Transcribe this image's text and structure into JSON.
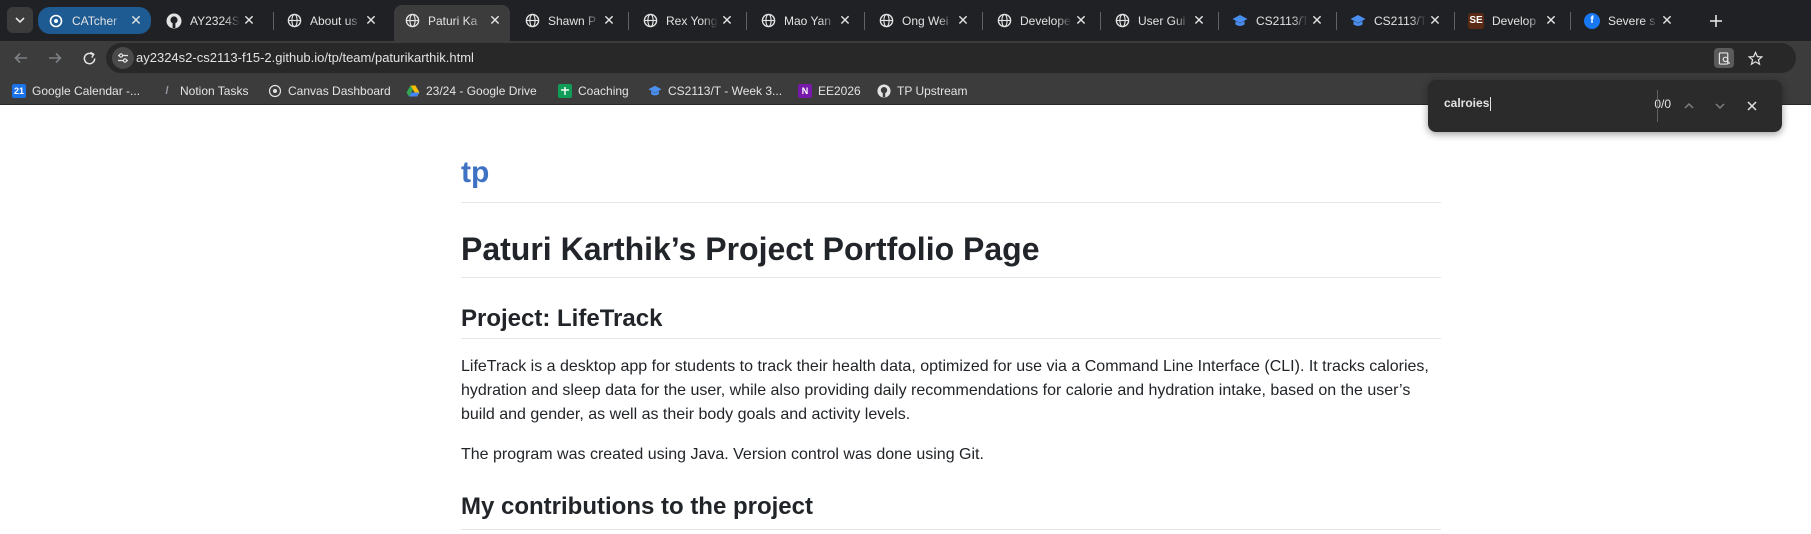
{
  "browser": {
    "tabs": [
      {
        "title": "CATcher",
        "icon": "catcher-icon",
        "color": "#1d5b92"
      },
      {
        "title": "AY2324S",
        "icon": "github-icon"
      },
      {
        "title": "About us",
        "icon": "globe-icon"
      },
      {
        "title": "Paturi Ka",
        "icon": "globe-icon",
        "active": true
      },
      {
        "title": "Shawn P",
        "icon": "globe-icon"
      },
      {
        "title": "Rex Yong",
        "icon": "globe-icon"
      },
      {
        "title": "Mao Yan",
        "icon": "globe-icon"
      },
      {
        "title": "Ong Wei",
        "icon": "globe-icon"
      },
      {
        "title": "Develope",
        "icon": "globe-icon"
      },
      {
        "title": "User Gui",
        "icon": "globe-icon"
      },
      {
        "title": "CS2113/T",
        "icon": "graduation-cap-icon"
      },
      {
        "title": "CS2113/T",
        "icon": "graduation-cap-icon"
      },
      {
        "title": "Develop",
        "icon": "se-edu-icon"
      },
      {
        "title": "Severe s",
        "icon": "facebook-icon"
      }
    ],
    "url": "ay2324s2-cs2113-f15-2.github.io/tp/team/paturikarthik.html",
    "bookmarks": [
      {
        "label": "Google Calendar -...",
        "icon": "google-calendar-icon"
      },
      {
        "label": "Notion Tasks",
        "icon": "notion-icon"
      },
      {
        "label": "Canvas Dashboard",
        "icon": "canvas-icon"
      },
      {
        "label": "23/24 - Google Drive",
        "icon": "google-drive-icon"
      },
      {
        "label": "Coaching",
        "icon": "coaching-icon"
      },
      {
        "label": "CS2113/T - Week 3...",
        "icon": "graduation-cap-icon"
      },
      {
        "label": "EE2026",
        "icon": "onenote-icon"
      },
      {
        "label": "TP Upstream",
        "icon": "github-icon"
      }
    ]
  },
  "find_bar": {
    "query": "calroies",
    "count": "0/0"
  },
  "page": {
    "site_title": "tp",
    "heading": "Paturi Karthik’s Project Portfolio Page",
    "project_heading": "Project: LifeTrack",
    "paragraph_1": "LifeTrack is a desktop app for students to track their health data, optimized for use via a Command Line Interface (CLI). It tracks calories, hydration and sleep data for the user, while also providing daily recommendations for calorie and hydration intake, based on the user’s build and gender, as well as their body goals and activity levels.",
    "paragraph_2": "The program was created using Java. Version control was done using Git.",
    "contributions_heading": "My contributions to the project"
  },
  "colors": {
    "tab_strip": "#202124",
    "toolbar": "#3c3c3c",
    "link_title": "#3f72c3",
    "catcher_tab": "#1d5b92"
  }
}
